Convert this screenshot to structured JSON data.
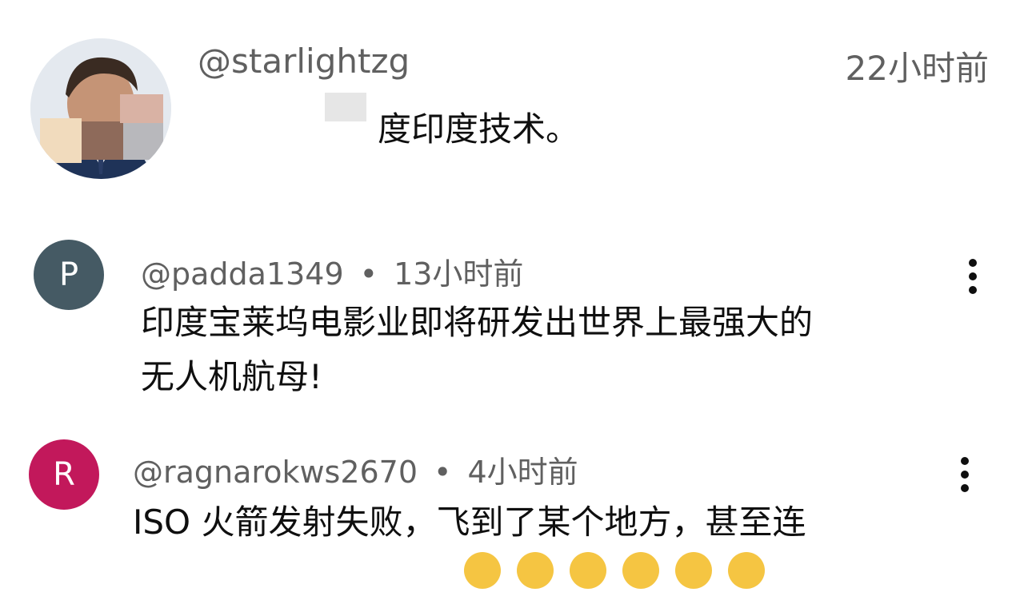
{
  "top_comment": {
    "handle": "@starlightzg",
    "time": "22小时前",
    "text": "度印度技术。"
  },
  "replies": [
    {
      "avatar_letter": "P",
      "avatar_color": "#455a64",
      "handle": "@padda1349",
      "separator": "•",
      "time": "13小时前",
      "text_line1": "印度宝莱坞电影业即将研发出世界上最强大的",
      "text_line2": "无人机航母!"
    },
    {
      "avatar_letter": "R",
      "avatar_color": "#c2185b",
      "handle": "@ragnarokws2670",
      "separator": "•",
      "time": "4小时前",
      "text_line1": "ISO 火箭发射失败，飞到了某个地方，甚至连"
    }
  ],
  "icons": {
    "more": "more-vert-icon",
    "emoji": "laughing-emoji-icon"
  }
}
